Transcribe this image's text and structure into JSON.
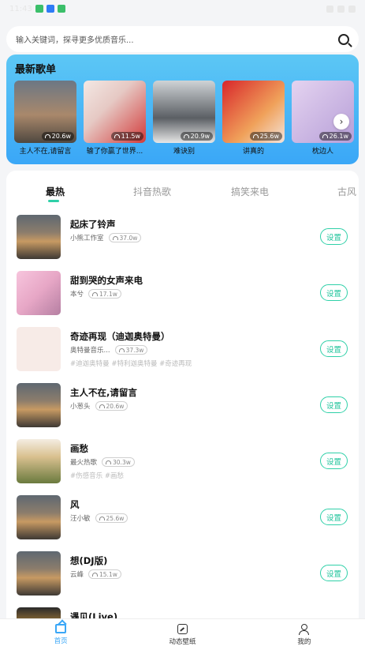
{
  "statusbar": {
    "time": "11:43"
  },
  "search": {
    "placeholder": "输入关键词，探寻更多优质音乐..."
  },
  "playlists": {
    "title": "最新歌单",
    "items": [
      {
        "name": "主人不在,请留言",
        "count": "20.6w"
      },
      {
        "name": "输了你赢了世界...",
        "count": "11.5w"
      },
      {
        "name": "难诀别",
        "count": "20.9w"
      },
      {
        "name": "讲真的",
        "count": "25.6w"
      },
      {
        "name": "枕边人",
        "count": "26.1w"
      }
    ]
  },
  "tabs": [
    "最热",
    "抖音热歌",
    "搞笑来电",
    "古风"
  ],
  "songs": [
    {
      "title": "起床了铃声",
      "artist": "小熊工作室",
      "plays": "37.0w",
      "tags": "",
      "action": "设置"
    },
    {
      "title": "甜到哭的女声来电",
      "artist": "本兮",
      "plays": "17.1w",
      "tags": "",
      "action": "设置"
    },
    {
      "title": "奇迹再现（迪迦奥特曼）",
      "artist": "奥特曼音乐...",
      "plays": "37.3w",
      "tags": "#迪迦奥特曼 #特利迦奥特曼 #奇迹再现",
      "action": "设置"
    },
    {
      "title": "主人不在,请留言",
      "artist": "小葱头",
      "plays": "20.6w",
      "tags": "",
      "action": "设置"
    },
    {
      "title": "画愁",
      "artist": "最火热歌",
      "plays": "30.3w",
      "tags": "#伤感音乐 #画愁",
      "action": "设置"
    },
    {
      "title": "风",
      "artist": "汪小敏",
      "plays": "25.6w",
      "tags": "",
      "action": "设置"
    },
    {
      "title": "想(DJ版)",
      "artist": "云峰",
      "plays": "15.1w",
      "tags": "",
      "action": "设置"
    },
    {
      "title": "遇见(Live)",
      "artist": "",
      "plays": "",
      "tags": "",
      "action": ""
    }
  ],
  "bottom_nav": [
    "首页",
    "动态壁纸",
    "我的"
  ]
}
